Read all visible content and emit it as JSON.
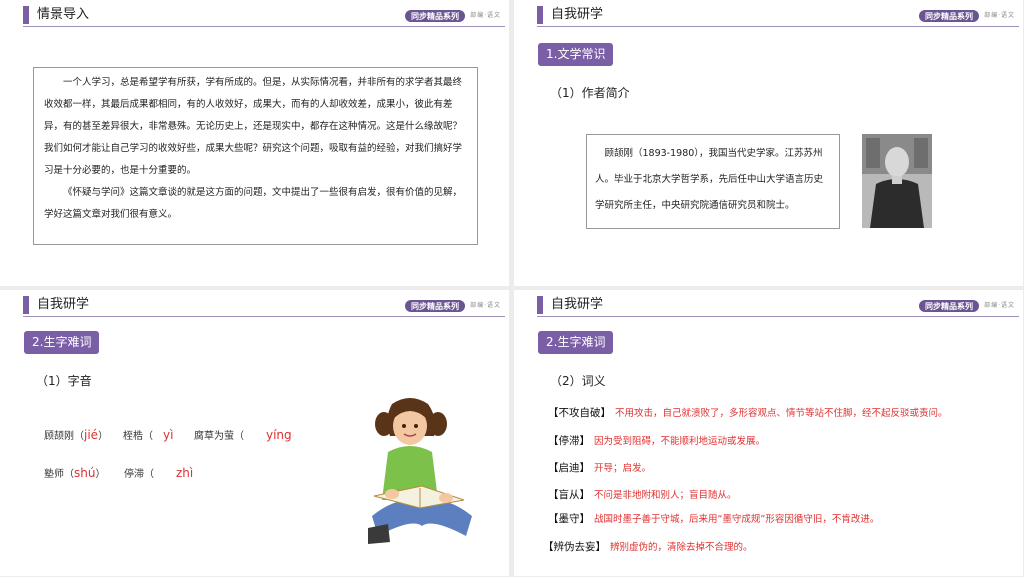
{
  "badge": {
    "main": "同步精品系列",
    "sub": "部编·语文"
  },
  "slide1": {
    "title": "情景导入",
    "para1": "一个人学习，总是希望学有所获，学有所成的。但是，从实际情况看，并非所有的求学者其最终收效都一样，其最后成果都相同，有的人收效好，成果大，而有的人却收效差，成果小，彼此有差异，有的甚至差异很大，非常悬殊。无论历史上，还是现实中，都存在这种情况。这是什么缘故呢？我们如何才能让自己学习的收效好些，成果大些呢？研究这个问题，吸取有益的经验，对我们搞好学习是十分必要的，也是十分重要的。",
    "para2": "《怀疑与学问》这篇文章谈的就是这方面的问题，文中提出了一些很有启发，很有价值的见解，学好这篇文章对我们很有意义。"
  },
  "slide2": {
    "title": "自我研学",
    "pill": "1.文学常识",
    "sub": "（1）作者简介",
    "bio": "顾颉刚（1893-1980），我国当代史学家。江苏苏州人。毕业于北京大学哲学系，先后任中山大学语言历史学研究所主任，中央研究院通信研究员和院士。"
  },
  "slide3": {
    "title": "自我研学",
    "pill": "2.生字难词",
    "sub": "（1）字音",
    "row1": [
      {
        "word": "顾颉刚（",
        "py": "jié",
        "end": "）"
      },
      {
        "word": "桎梏（",
        "py": "yì",
        "end": ""
      },
      {
        "word": "腐草为萤（",
        "py": "yíng",
        "end": ""
      }
    ],
    "row2": [
      {
        "word": "塾师（",
        "py": "shú",
        "end": "）"
      },
      {
        "word": "停滞（",
        "py": "zhì",
        "end": ""
      }
    ]
  },
  "slide4": {
    "title": "自我研学",
    "pill": "2.生字难词",
    "sub": "（2）词义",
    "items": [
      {
        "term": "【不攻自破】",
        "def": "不用攻击，自己就溃败了，多形容观点、情节等站不住脚，经不起反驳或责问。"
      },
      {
        "term": "【停滞】",
        "def": "因为受到阻碍，不能顺利地运动或发展。"
      },
      {
        "term": "【启迪】",
        "def": "开导；启发。"
      },
      {
        "term": "【盲从】",
        "def": "不问是非地附和别人；盲目随从。"
      },
      {
        "term": "【墨守】",
        "def": "战国时墨子善于守城，后来用“墨守成规”形容因循守旧，不肯改进。"
      },
      {
        "term": "【辨伪去妄】",
        "def": "辨别虚伪的，清除去掉不合理的。"
      }
    ]
  }
}
